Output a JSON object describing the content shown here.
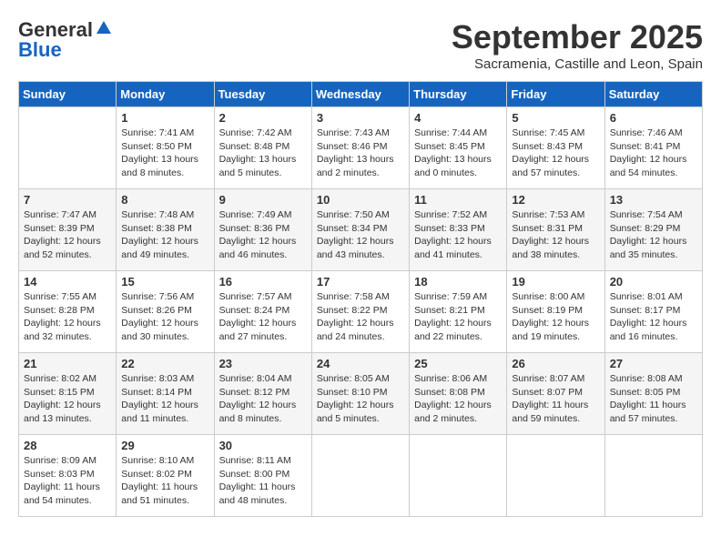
{
  "header": {
    "logo_general": "General",
    "logo_blue": "Blue",
    "month": "September 2025",
    "location": "Sacramenia, Castille and Leon, Spain"
  },
  "weekdays": [
    "Sunday",
    "Monday",
    "Tuesday",
    "Wednesday",
    "Thursday",
    "Friday",
    "Saturday"
  ],
  "weeks": [
    [
      {
        "day": "",
        "sunrise": "",
        "sunset": "",
        "daylight": ""
      },
      {
        "day": "1",
        "sunrise": "Sunrise: 7:41 AM",
        "sunset": "Sunset: 8:50 PM",
        "daylight": "Daylight: 13 hours and 8 minutes."
      },
      {
        "day": "2",
        "sunrise": "Sunrise: 7:42 AM",
        "sunset": "Sunset: 8:48 PM",
        "daylight": "Daylight: 13 hours and 5 minutes."
      },
      {
        "day": "3",
        "sunrise": "Sunrise: 7:43 AM",
        "sunset": "Sunset: 8:46 PM",
        "daylight": "Daylight: 13 hours and 2 minutes."
      },
      {
        "day": "4",
        "sunrise": "Sunrise: 7:44 AM",
        "sunset": "Sunset: 8:45 PM",
        "daylight": "Daylight: 13 hours and 0 minutes."
      },
      {
        "day": "5",
        "sunrise": "Sunrise: 7:45 AM",
        "sunset": "Sunset: 8:43 PM",
        "daylight": "Daylight: 12 hours and 57 minutes."
      },
      {
        "day": "6",
        "sunrise": "Sunrise: 7:46 AM",
        "sunset": "Sunset: 8:41 PM",
        "daylight": "Daylight: 12 hours and 54 minutes."
      }
    ],
    [
      {
        "day": "7",
        "sunrise": "Sunrise: 7:47 AM",
        "sunset": "Sunset: 8:39 PM",
        "daylight": "Daylight: 12 hours and 52 minutes."
      },
      {
        "day": "8",
        "sunrise": "Sunrise: 7:48 AM",
        "sunset": "Sunset: 8:38 PM",
        "daylight": "Daylight: 12 hours and 49 minutes."
      },
      {
        "day": "9",
        "sunrise": "Sunrise: 7:49 AM",
        "sunset": "Sunset: 8:36 PM",
        "daylight": "Daylight: 12 hours and 46 minutes."
      },
      {
        "day": "10",
        "sunrise": "Sunrise: 7:50 AM",
        "sunset": "Sunset: 8:34 PM",
        "daylight": "Daylight: 12 hours and 43 minutes."
      },
      {
        "day": "11",
        "sunrise": "Sunrise: 7:52 AM",
        "sunset": "Sunset: 8:33 PM",
        "daylight": "Daylight: 12 hours and 41 minutes."
      },
      {
        "day": "12",
        "sunrise": "Sunrise: 7:53 AM",
        "sunset": "Sunset: 8:31 PM",
        "daylight": "Daylight: 12 hours and 38 minutes."
      },
      {
        "day": "13",
        "sunrise": "Sunrise: 7:54 AM",
        "sunset": "Sunset: 8:29 PM",
        "daylight": "Daylight: 12 hours and 35 minutes."
      }
    ],
    [
      {
        "day": "14",
        "sunrise": "Sunrise: 7:55 AM",
        "sunset": "Sunset: 8:28 PM",
        "daylight": "Daylight: 12 hours and 32 minutes."
      },
      {
        "day": "15",
        "sunrise": "Sunrise: 7:56 AM",
        "sunset": "Sunset: 8:26 PM",
        "daylight": "Daylight: 12 hours and 30 minutes."
      },
      {
        "day": "16",
        "sunrise": "Sunrise: 7:57 AM",
        "sunset": "Sunset: 8:24 PM",
        "daylight": "Daylight: 12 hours and 27 minutes."
      },
      {
        "day": "17",
        "sunrise": "Sunrise: 7:58 AM",
        "sunset": "Sunset: 8:22 PM",
        "daylight": "Daylight: 12 hours and 24 minutes."
      },
      {
        "day": "18",
        "sunrise": "Sunrise: 7:59 AM",
        "sunset": "Sunset: 8:21 PM",
        "daylight": "Daylight: 12 hours and 22 minutes."
      },
      {
        "day": "19",
        "sunrise": "Sunrise: 8:00 AM",
        "sunset": "Sunset: 8:19 PM",
        "daylight": "Daylight: 12 hours and 19 minutes."
      },
      {
        "day": "20",
        "sunrise": "Sunrise: 8:01 AM",
        "sunset": "Sunset: 8:17 PM",
        "daylight": "Daylight: 12 hours and 16 minutes."
      }
    ],
    [
      {
        "day": "21",
        "sunrise": "Sunrise: 8:02 AM",
        "sunset": "Sunset: 8:15 PM",
        "daylight": "Daylight: 12 hours and 13 minutes."
      },
      {
        "day": "22",
        "sunrise": "Sunrise: 8:03 AM",
        "sunset": "Sunset: 8:14 PM",
        "daylight": "Daylight: 12 hours and 11 minutes."
      },
      {
        "day": "23",
        "sunrise": "Sunrise: 8:04 AM",
        "sunset": "Sunset: 8:12 PM",
        "daylight": "Daylight: 12 hours and 8 minutes."
      },
      {
        "day": "24",
        "sunrise": "Sunrise: 8:05 AM",
        "sunset": "Sunset: 8:10 PM",
        "daylight": "Daylight: 12 hours and 5 minutes."
      },
      {
        "day": "25",
        "sunrise": "Sunrise: 8:06 AM",
        "sunset": "Sunset: 8:08 PM",
        "daylight": "Daylight: 12 hours and 2 minutes."
      },
      {
        "day": "26",
        "sunrise": "Sunrise: 8:07 AM",
        "sunset": "Sunset: 8:07 PM",
        "daylight": "Daylight: 11 hours and 59 minutes."
      },
      {
        "day": "27",
        "sunrise": "Sunrise: 8:08 AM",
        "sunset": "Sunset: 8:05 PM",
        "daylight": "Daylight: 11 hours and 57 minutes."
      }
    ],
    [
      {
        "day": "28",
        "sunrise": "Sunrise: 8:09 AM",
        "sunset": "Sunset: 8:03 PM",
        "daylight": "Daylight: 11 hours and 54 minutes."
      },
      {
        "day": "29",
        "sunrise": "Sunrise: 8:10 AM",
        "sunset": "Sunset: 8:02 PM",
        "daylight": "Daylight: 11 hours and 51 minutes."
      },
      {
        "day": "30",
        "sunrise": "Sunrise: 8:11 AM",
        "sunset": "Sunset: 8:00 PM",
        "daylight": "Daylight: 11 hours and 48 minutes."
      },
      {
        "day": "",
        "sunrise": "",
        "sunset": "",
        "daylight": ""
      },
      {
        "day": "",
        "sunrise": "",
        "sunset": "",
        "daylight": ""
      },
      {
        "day": "",
        "sunrise": "",
        "sunset": "",
        "daylight": ""
      },
      {
        "day": "",
        "sunrise": "",
        "sunset": "",
        "daylight": ""
      }
    ]
  ]
}
